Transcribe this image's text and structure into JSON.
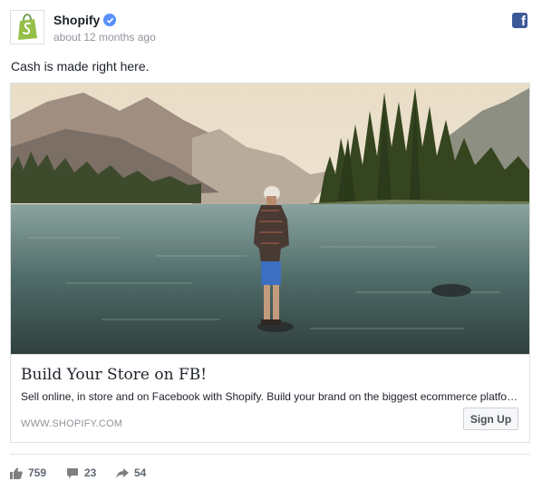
{
  "post": {
    "page_name": "Shopify",
    "timestamp": "about 12 months ago",
    "text": "Cash is made right here.",
    "avatar_icon": "shopify-bag-icon",
    "network_icon": "facebook-icon",
    "network_glyph": "f"
  },
  "link_card": {
    "title": "Build Your Store on FB!",
    "description": "Sell online, in store and on Facebook with Shopify. Build your brand on the biggest ecommerce platform",
    "domain": "WWW.SHOPIFY.COM",
    "cta_label": "Sign Up"
  },
  "stats": {
    "likes": "759",
    "comments": "23",
    "shares": "54"
  },
  "colors": {
    "brand_green": "#95bf47",
    "verified_blue": "#5890ff",
    "facebook_blue": "#3b5998",
    "muted_text": "#90949c"
  }
}
